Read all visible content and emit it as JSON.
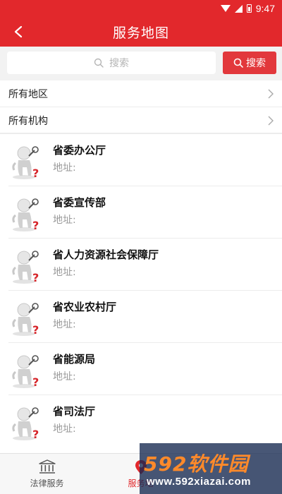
{
  "status_bar": {
    "time": "9:47"
  },
  "header": {
    "title": "服务地图",
    "back_icon": "arrow-left-icon"
  },
  "search": {
    "placeholder": "搜索",
    "button_label": "搜索"
  },
  "filters": [
    {
      "label": "所有地区"
    },
    {
      "label": "所有机构"
    }
  ],
  "orgs": [
    {
      "name": "省委办公厅",
      "address_label": "地址:"
    },
    {
      "name": "省委宣传部",
      "address_label": "地址:"
    },
    {
      "name": "省人力资源社会保障厅",
      "address_label": "地址:"
    },
    {
      "name": "省农业农村厅",
      "address_label": "地址:"
    },
    {
      "name": "省能源局",
      "address_label": "地址:"
    },
    {
      "name": "省司法厅",
      "address_label": "地址:"
    }
  ],
  "tabs": [
    {
      "label": "法律服务",
      "icon": "bank-icon"
    },
    {
      "label": "服务地",
      "icon": "map-pin-icon"
    }
  ],
  "watermark": {
    "logo": "592软件园",
    "url": "www.592xiazai.com"
  },
  "colors": {
    "primary": "#e2282c",
    "search_button": "#e2383c"
  }
}
